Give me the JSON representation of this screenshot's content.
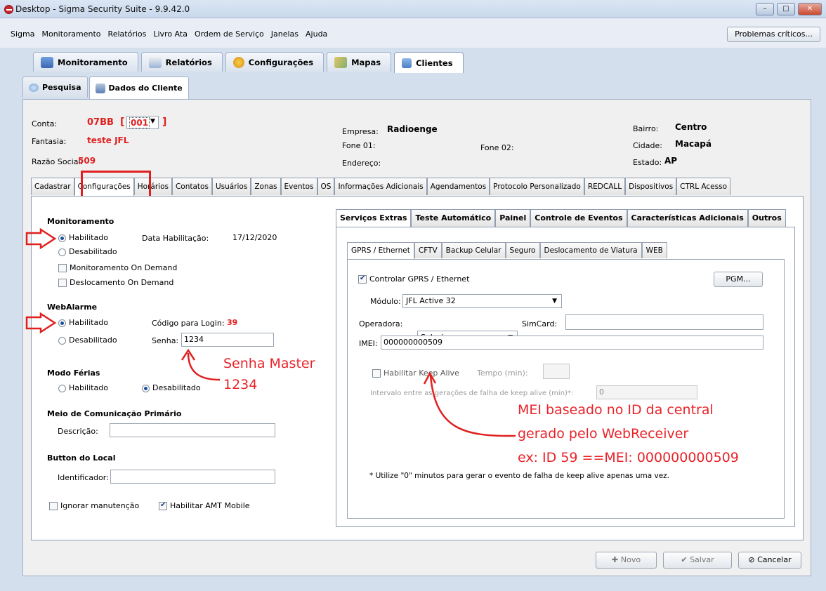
{
  "window": {
    "title": "Desktop - Sigma Security Suite - 9.9.42.0",
    "minimize": "–",
    "maximize": "□",
    "close": "✕"
  },
  "menu": [
    "Sigma",
    "Monitoramento",
    "Relatórios",
    "Livro Ata",
    "Ordem de Serviço",
    "Janelas",
    "Ajuda"
  ],
  "problems_button": "Problemas críticos...",
  "main_tabs": [
    {
      "label": "Monitoramento",
      "icon": "monitor-people-icon"
    },
    {
      "label": "Relatórios",
      "icon": "reports-icon"
    },
    {
      "label": "Configurações",
      "icon": "gear-icon"
    },
    {
      "label": "Mapas",
      "icon": "map-icon"
    },
    {
      "label": "Clientes",
      "icon": "clients-icon"
    }
  ],
  "sub_tabs": [
    {
      "label": "Pesquisa",
      "icon": "search-icon"
    },
    {
      "label": "Dados do Cliente",
      "icon": "database-icon"
    }
  ],
  "client": {
    "conta_label": "Conta:",
    "conta_value": "07BB",
    "conta_open": "[",
    "partition": "001",
    "conta_close": "]",
    "fantasia_label": "Fantasia:",
    "fantasia_value": "teste JFL",
    "razao_label": "Razão Social:",
    "razao_value": "509",
    "empresa_label": "Empresa:",
    "empresa_value": "Radioenge",
    "fone01_label": "Fone 01:",
    "fone02_label": "Fone 02:",
    "endereco_label": "Endereço:",
    "bairro_label": "Bairro:",
    "bairro_value": "Centro",
    "cidade_label": "Cidade:",
    "cidade_value": "Macapá",
    "estado_label": "Estado:",
    "estado_value": "AP"
  },
  "client_tabs": [
    "Cadastrar",
    "Configurações",
    "Horários",
    "Contatos",
    "Usuários",
    "Zonas",
    "Eventos",
    "OS",
    "Informações Adicionais",
    "Agendamentos",
    "Protocolo Personalizado",
    "REDCALL",
    "Dispositivos",
    "CTRL Acesso"
  ],
  "left": {
    "monitoramento_title": "Monitoramento",
    "habilitado": "Habilitado",
    "desabilitado": "Desabilitado",
    "data_hab_label": "Data Habilitação:",
    "data_hab_value": "17/12/2020",
    "mon_on_demand": "Monitoramento On Demand",
    "desl_on_demand": "Deslocamento On Demand",
    "webalarme_title": "WebAlarme",
    "codigo_label": "Código para Login:",
    "codigo_value": "39",
    "senha_label": "Senha:",
    "senha_value": "1234",
    "ferias_title": "Modo Férias",
    "meio_title": "Meio de Comunicação Primário",
    "descricao_label": "Descrição:",
    "button_title": "Button do Local",
    "identificador_label": "Identificador:",
    "ignorar": "Ignorar manutenção",
    "amt": "Habilitar AMT Mobile"
  },
  "right_tabs": [
    "Serviços Extras",
    "Teste Automático",
    "Painel",
    "Controle de Eventos",
    "Características Adicionais",
    "Outros"
  ],
  "gprs_tabs": [
    "GPRS / Ethernet",
    "CFTV",
    "Backup Celular",
    "Seguro",
    "Deslocamento de Viatura",
    "WEB"
  ],
  "gprs": {
    "controlar": "Controlar GPRS / Ethernet",
    "pgm": "PGM...",
    "modulo_label": "Módulo:",
    "modulo_value": "JFL Active 32",
    "operadora_label": "Operadora:",
    "operadora_value": "Selecione...",
    "simcard_label": "SimCard:",
    "imei_label": "IMEI:",
    "imei_value": "000000000509",
    "keepalive": "Habilitar Keep Alive",
    "tempo_label": "Tempo (min):",
    "intervalo_label": "Intervalo entre as gerações de falha de keep alive (min)*:",
    "intervalo_value": "0",
    "nota": "* Utilize \"0\" minutos para gerar o evento de falha de keep alive apenas uma vez."
  },
  "footer": {
    "novo": "Novo",
    "salvar": "Salvar",
    "cancelar": "Cancelar"
  },
  "annotations": {
    "senha1": "Senha Master",
    "senha2": "1234",
    "mei1": "MEI baseado no ID da central",
    "mei2": "gerado pelo WebReceiver",
    "mei3": "ex: ID 59 ==MEI: 000000000509"
  },
  "colors": {
    "accent_red": "#e02020",
    "annotation": "#e8242a"
  }
}
